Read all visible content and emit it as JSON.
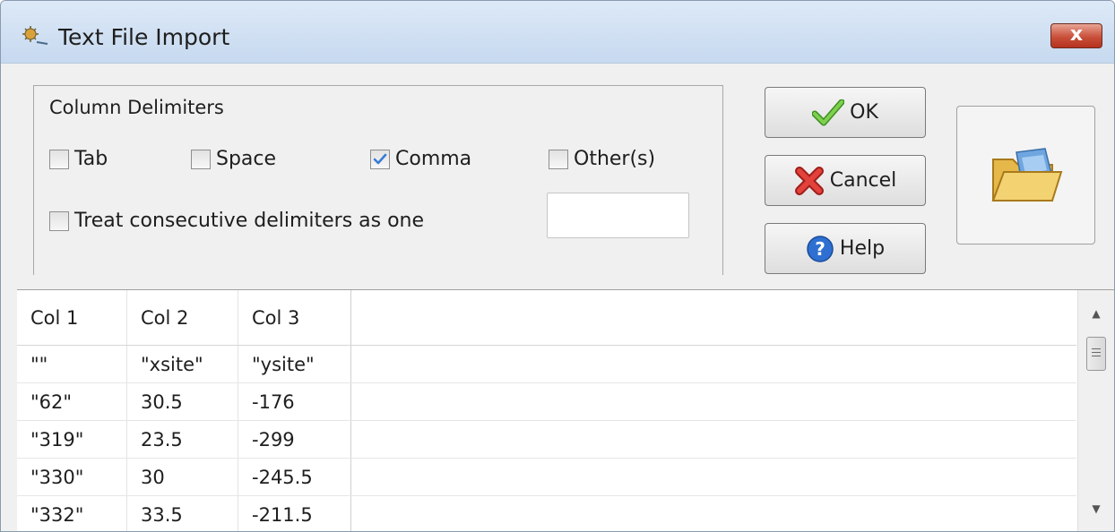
{
  "window": {
    "title": "Text File Import",
    "close_label": "x"
  },
  "delimiters": {
    "group_label": "Column Delimiters",
    "options": [
      {
        "label": "Tab",
        "checked": false
      },
      {
        "label": "Space",
        "checked": false
      },
      {
        "label": "Comma",
        "checked": true
      },
      {
        "label": "Other(s)",
        "checked": false
      }
    ],
    "consecutive": {
      "label": "Treat consecutive delimiters as one",
      "checked": false
    },
    "other_value": ""
  },
  "buttons": {
    "ok": {
      "label": "OK",
      "icon": "check-icon"
    },
    "cancel": {
      "label": "Cancel",
      "icon": "red-x-icon"
    },
    "help": {
      "label": "Help",
      "icon": "help-icon"
    },
    "open": {
      "icon": "open-folder-icon"
    }
  },
  "grid": {
    "headers": [
      "Col 1",
      "Col 2",
      "Col 3"
    ],
    "rows": [
      [
        "\"\"",
        "\"xsite\"",
        "\"ysite\""
      ],
      [
        "\"62\"",
        "30.5",
        "-176"
      ],
      [
        "\"319\"",
        "23.5",
        "-299"
      ],
      [
        "\"330\"",
        "30",
        "-245.5"
      ],
      [
        "\"332\"",
        "33.5",
        "-211.5"
      ]
    ]
  },
  "colors": {
    "accent_check": "#3a7bd5",
    "ok_green": "#5cb531",
    "cancel_red": "#d9312c",
    "help_blue": "#2e6fd1"
  }
}
